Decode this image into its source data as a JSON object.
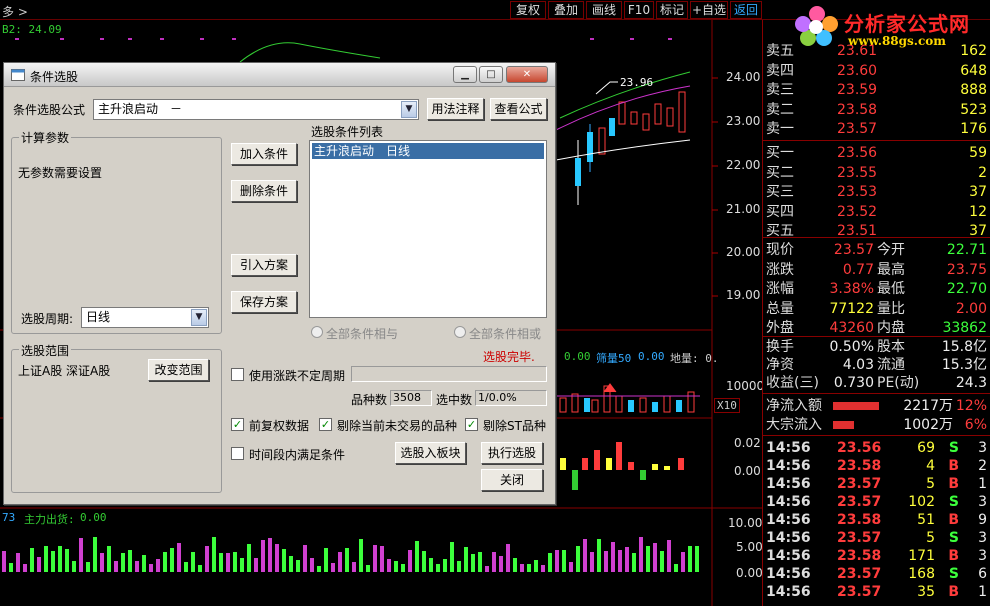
{
  "topbar": {
    "crumb": "多 >",
    "buttons": [
      "复权",
      "叠加",
      "画线",
      "F10",
      "标记",
      "+自选",
      "返回"
    ]
  },
  "chart": {
    "b2_label": "B2: 24.09",
    "price_marker": "23.96",
    "vol_legend": {
      "prefix": "0.00",
      "name": "筛量50",
      "value": "0.00",
      "extra": "地量: 0."
    },
    "vol_multiplier": "X10",
    "flow_legend": {
      "index": "73",
      "name": "主力出货:",
      "value": "0.00"
    },
    "price_axis": [
      "24.00",
      "23.00",
      "22.00",
      "21.00",
      "20.00",
      "19.00"
    ],
    "vol_axis": [
      "10000"
    ],
    "ind_axis": [
      "0.02",
      "0.00"
    ],
    "flow_axis": [
      "10.00",
      "5.00",
      "0.00"
    ]
  },
  "logo": {
    "title": "分析家公式网",
    "url": "www.88gs.com"
  },
  "quote": {
    "ask": [
      {
        "k": "卖五",
        "p": "23.61",
        "v": "162"
      },
      {
        "k": "卖四",
        "p": "23.60",
        "v": "648"
      },
      {
        "k": "卖三",
        "p": "23.59",
        "v": "888"
      },
      {
        "k": "卖二",
        "p": "23.58",
        "v": "523"
      },
      {
        "k": "卖一",
        "p": "23.57",
        "v": "176"
      }
    ],
    "bid": [
      {
        "k": "买一",
        "p": "23.56",
        "v": "59"
      },
      {
        "k": "买二",
        "p": "23.55",
        "v": "2"
      },
      {
        "k": "买三",
        "p": "23.53",
        "v": "37"
      },
      {
        "k": "买四",
        "p": "23.52",
        "v": "12"
      },
      {
        "k": "买五",
        "p": "23.51",
        "v": "37"
      }
    ],
    "stats": [
      {
        "k1": "现价",
        "v1": "23.57",
        "c1": "red",
        "k2": "今开",
        "v2": "22.71",
        "c2": "green"
      },
      {
        "k1": "涨跌",
        "v1": "0.77",
        "c1": "red",
        "k2": "最高",
        "v2": "23.75",
        "c2": "red"
      },
      {
        "k1": "涨幅",
        "v1": "3.38%",
        "c1": "red",
        "k2": "最低",
        "v2": "22.70",
        "c2": "green"
      },
      {
        "k1": "总量",
        "v1": "77122",
        "c1": "yellow",
        "k2": "量比",
        "v2": "2.00",
        "c2": "red"
      },
      {
        "k1": "外盘",
        "v1": "43260",
        "c1": "red",
        "k2": "内盘",
        "v2": "33862",
        "c2": "green"
      }
    ],
    "fund": [
      {
        "k1": "换手",
        "v1": "0.50%",
        "k2": "股本",
        "v2": "15.8亿"
      },
      {
        "k1": "净资",
        "v1": "4.03",
        "k2": "流通",
        "v2": "15.3亿"
      },
      {
        "k1": "收益(三)",
        "v1": "0.730",
        "k2": "PE(动)",
        "v2": "24.3"
      }
    ],
    "flow": [
      {
        "k": "净流入额",
        "amt": "2217万",
        "pct": "12%",
        "bar": 0.35
      },
      {
        "k": "大宗流入",
        "amt": "1002万",
        "pct": "6%",
        "bar": 0.16
      }
    ],
    "ticks": [
      {
        "t": "14:56",
        "p": "23.56",
        "v": "69",
        "d": "S",
        "n": "3"
      },
      {
        "t": "14:56",
        "p": "23.58",
        "v": "4",
        "d": "B",
        "n": "2"
      },
      {
        "t": "14:56",
        "p": "23.57",
        "v": "5",
        "d": "B",
        "n": "1"
      },
      {
        "t": "14:56",
        "p": "23.57",
        "v": "102",
        "d": "S",
        "n": "3"
      },
      {
        "t": "14:56",
        "p": "23.58",
        "v": "51",
        "d": "B",
        "n": "9"
      },
      {
        "t": "14:56",
        "p": "23.57",
        "v": "5",
        "d": "S",
        "n": "3"
      },
      {
        "t": "14:56",
        "p": "23.58",
        "v": "171",
        "d": "B",
        "n": "3"
      },
      {
        "t": "14:56",
        "p": "23.57",
        "v": "168",
        "d": "S",
        "n": "6"
      },
      {
        "t": "14:56",
        "p": "23.57",
        "v": "35",
        "d": "B",
        "n": "1"
      }
    ]
  },
  "dialog": {
    "title": "条件选股",
    "formula_label": "条件选股公式",
    "formula_value": "主升浪启动　－",
    "usage_btn": "用法注释",
    "view_btn": "查看公式",
    "calc_group": "计算参数",
    "no_params": "无参数需要设置",
    "add_btn": "加入条件",
    "del_btn": "删除条件",
    "import_btn": "引入方案",
    "save_btn": "保存方案",
    "list_title": "选股条件列表",
    "list_items": [
      "主升浪启动　日线"
    ],
    "period_label": "选股周期:",
    "period_value": "日线",
    "radio_and": "全部条件相与",
    "radio_or": "全部条件相或",
    "status": "选股完毕.",
    "range_group": "选股范围",
    "range_text": "上证A股 深证A股",
    "range_btn": "改变范围",
    "use_var_period": "使用涨跌不定周期",
    "count_label": "品种数",
    "count_value": "3508",
    "selected_label": "选中数",
    "selected_value": "1/0.0%",
    "chk_adjust": "前复权数据",
    "chk_untraded": "剔除当前未交易的品种",
    "chk_st": "剔除ST品种",
    "chk_time": "时间段内满足条件",
    "to_block_btn": "选股入板块",
    "exec_btn": "执行选股",
    "close_btn": "关闭"
  }
}
